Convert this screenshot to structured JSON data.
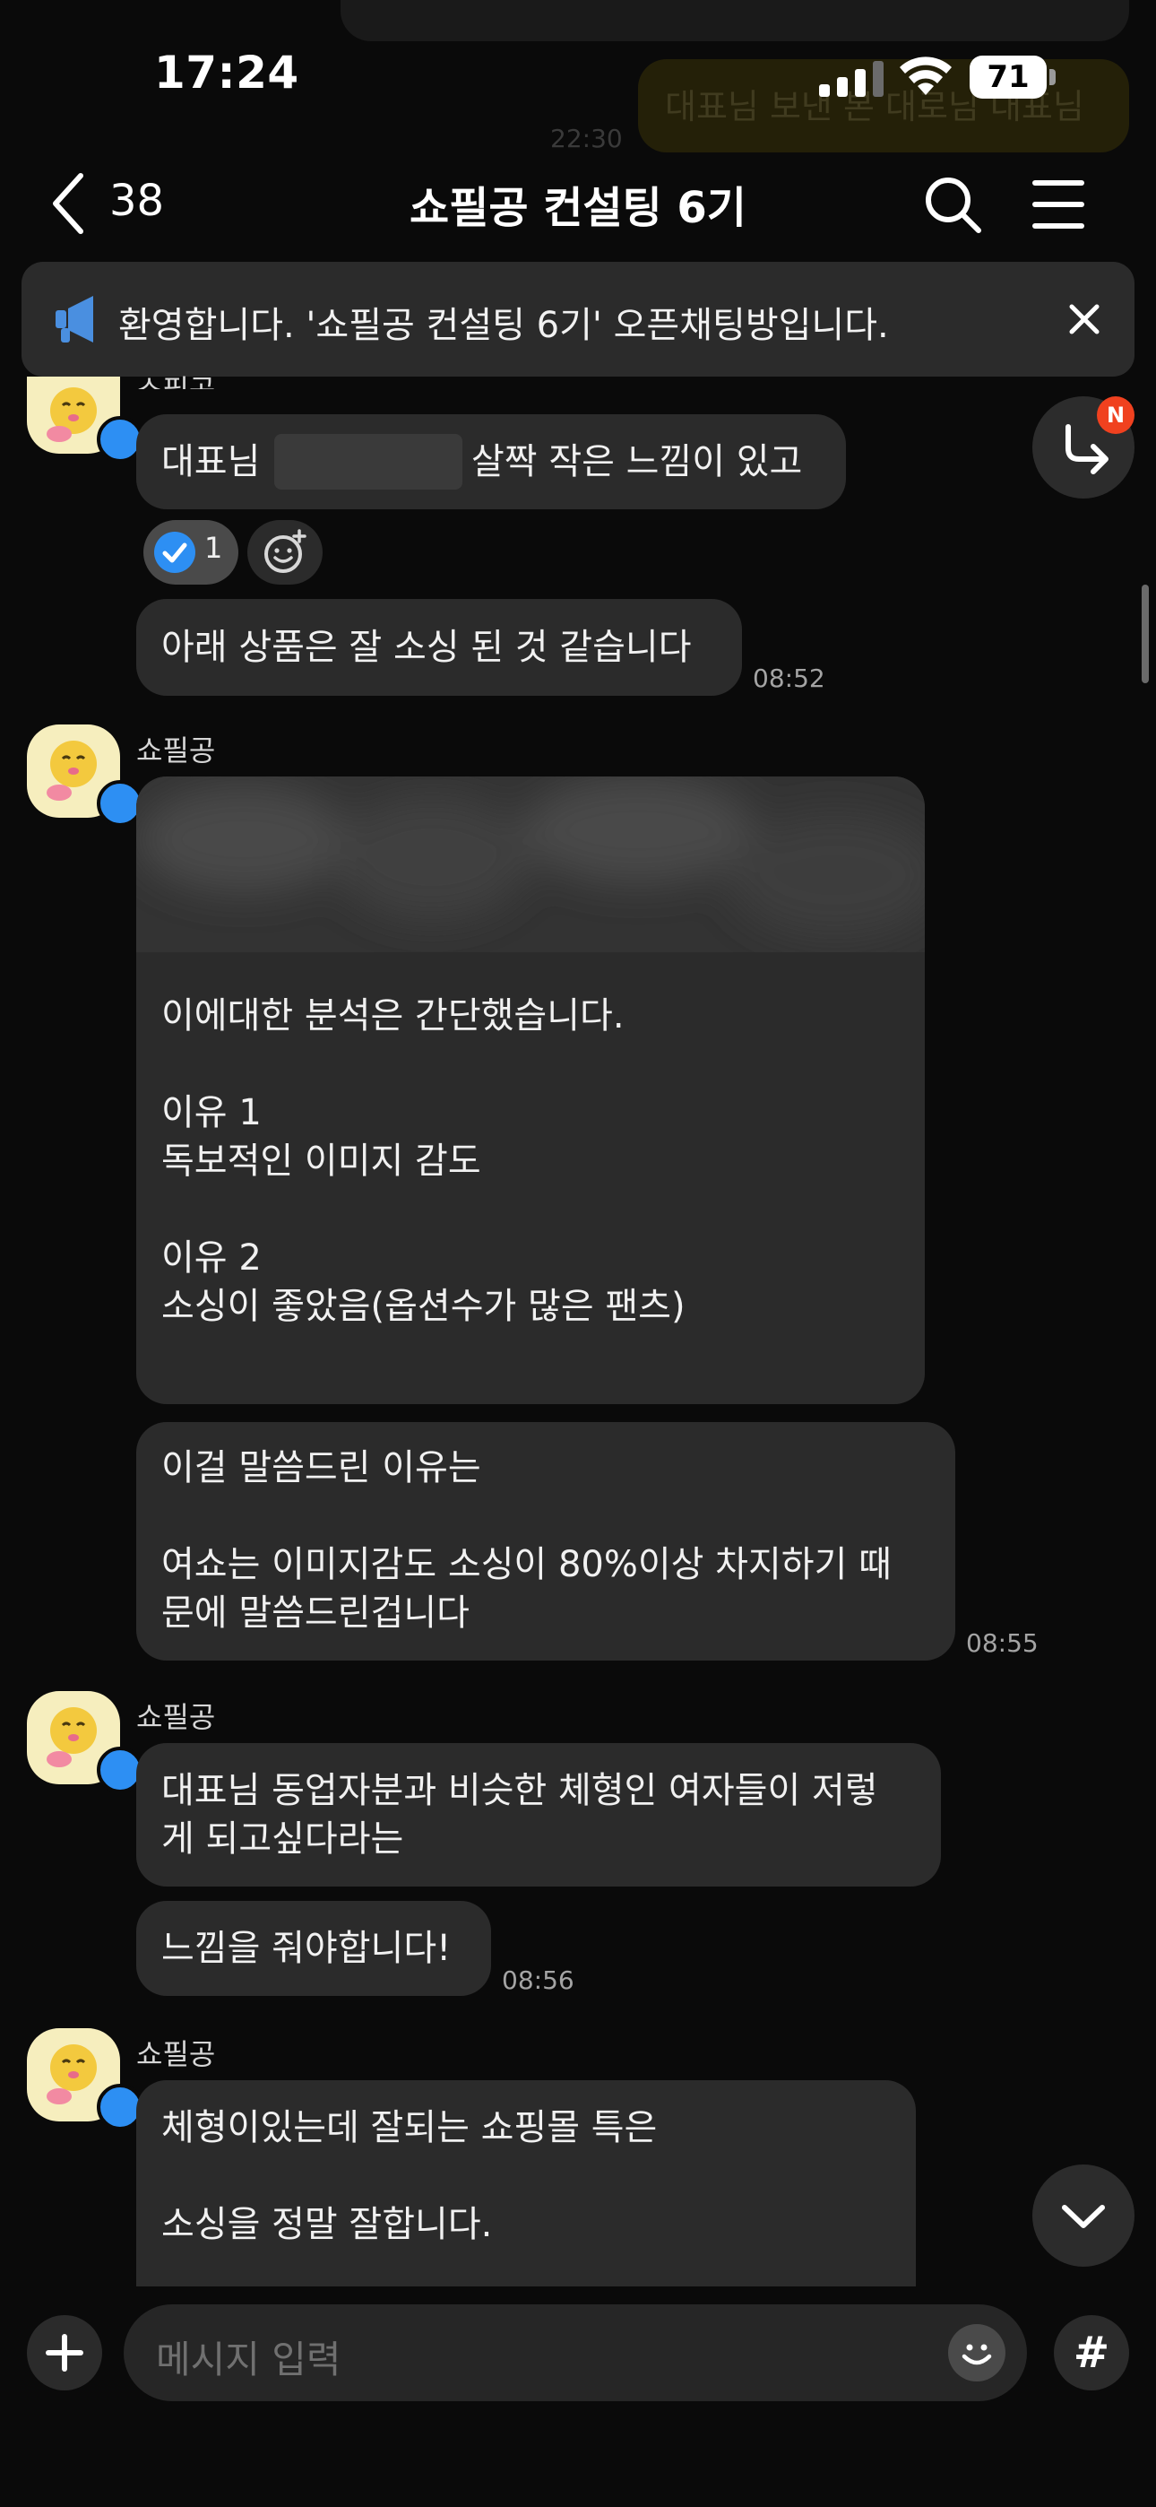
{
  "background_residue": {
    "bubble_text": "대표님 보낸 본 대로님 대표님",
    "time": "22:30"
  },
  "status_bar": {
    "time": "17:24",
    "battery": "71"
  },
  "header": {
    "unread_count": "38",
    "title": "쇼필공 컨설팅 6기"
  },
  "notice": {
    "text": "환영합니다. '쇼필공 컨설팅 6기' 오픈채팅방입니다."
  },
  "messages": {
    "g1": {
      "sender": "쇼필공",
      "b1_before": "대표님",
      "b1_after": "살짝 작은 느낌이 있고",
      "reaction_count": "1",
      "b2": "아래 상품은 잘 소싱 된 것 같습니다",
      "time": "08:52"
    },
    "g2": {
      "sender": "쇼필공",
      "card_lines": [
        "이에대한 분석은 간단했습니다.",
        "",
        "이유 1",
        "독보적인 이미지 감도",
        "",
        "이유 2",
        "소싱이 좋았음(옵션수가 많은 팬츠)"
      ],
      "b2_lines": [
        "이걸 말씀드린 이유는",
        "",
        "여쇼는 이미지감도 소싱이 80%이상 차지하기 때",
        "문에 말씀드린겁니다"
      ],
      "time": "08:55"
    },
    "g3": {
      "sender": "쇼필공",
      "b1_lines": [
        "대표님 동업자분과 비슷한 체형인 여자들이 저렇",
        "게 되고싶다라는"
      ],
      "b2": "느낌을 줘야합니다!",
      "time": "08:56"
    },
    "g4": {
      "sender": "쇼필공",
      "b1_lines": [
        "체형이있는데 잘되는 쇼핑몰 특은",
        "",
        "소싱을 정말 잘합니다."
      ]
    }
  },
  "floating": {
    "reply_badge": "N"
  },
  "composer": {
    "placeholder": "메시지 입력",
    "hash_label": "#"
  },
  "colors": {
    "background": "#0a0a0a",
    "bubble": "#2b2b2b",
    "accent_blue": "#2d8ff3",
    "badge_red": "#f0411f"
  }
}
